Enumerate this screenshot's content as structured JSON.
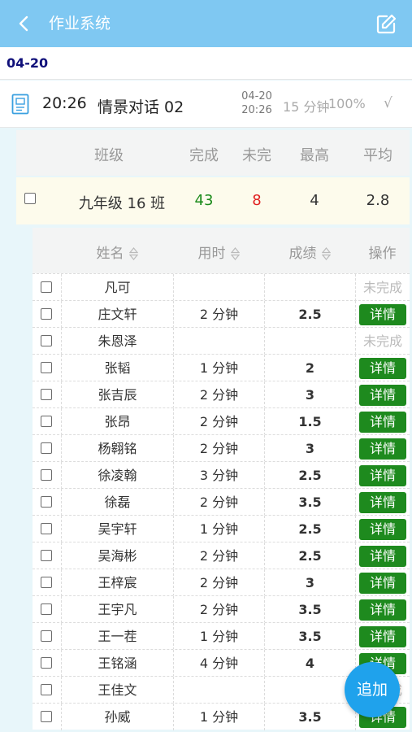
{
  "header": {
    "title": "作业系统",
    "back_icon": "chevron-left-icon",
    "edit_icon": "edit-square-icon"
  },
  "date_group": "04-20",
  "homework": {
    "time": "20:26",
    "name": "情景对话 02",
    "date_line1": "04-20",
    "date_line2": "20:26",
    "duration": "15 分钟",
    "percent": "100%",
    "status_mark": "√"
  },
  "class_table": {
    "headers": [
      "班级",
      "完成",
      "未完",
      "最高",
      "平均"
    ],
    "row": {
      "class_name": "九年级 16 班",
      "done": "43",
      "undone": "8",
      "max": "4",
      "avg": "2.8"
    },
    "colors": {
      "done": "#1a8a1a",
      "undone": "#e02020"
    }
  },
  "student_table": {
    "headers": {
      "name": "姓名",
      "time": "用时",
      "score": "成绩",
      "op": "操作"
    },
    "detail_label": "详情",
    "undone_label": "未完成",
    "rows": [
      {
        "name": "凡可",
        "time": "",
        "score": "",
        "done": false
      },
      {
        "name": "庄文轩",
        "time": "2 分钟",
        "score": "2.5",
        "done": true
      },
      {
        "name": "朱恩泽",
        "time": "",
        "score": "",
        "done": false
      },
      {
        "name": "张韬",
        "time": "1 分钟",
        "score": "2",
        "done": true
      },
      {
        "name": "张吉辰",
        "time": "2 分钟",
        "score": "3",
        "done": true
      },
      {
        "name": "张昂",
        "time": "2 分钟",
        "score": "1.5",
        "done": true
      },
      {
        "name": "杨翱铭",
        "time": "2 分钟",
        "score": "3",
        "done": true
      },
      {
        "name": "徐凌翰",
        "time": "3 分钟",
        "score": "2.5",
        "done": true
      },
      {
        "name": "徐磊",
        "time": "2 分钟",
        "score": "3.5",
        "done": true
      },
      {
        "name": "吴宇轩",
        "time": "1 分钟",
        "score": "2.5",
        "done": true
      },
      {
        "name": "吴海彬",
        "time": "2 分钟",
        "score": "2.5",
        "done": true
      },
      {
        "name": "王梓宸",
        "time": "2 分钟",
        "score": "3",
        "done": true
      },
      {
        "name": "王宇凡",
        "time": "2 分钟",
        "score": "3.5",
        "done": true
      },
      {
        "name": "王一茬",
        "time": "1 分钟",
        "score": "3.5",
        "done": true
      },
      {
        "name": "王铭涵",
        "time": "4 分钟",
        "score": "4",
        "done": true
      },
      {
        "name": "王佳文",
        "time": "",
        "score": "",
        "done": false
      },
      {
        "name": "孙威",
        "time": "1 分钟",
        "score": "3.5",
        "done": true
      }
    ]
  },
  "fab_label": "追加"
}
